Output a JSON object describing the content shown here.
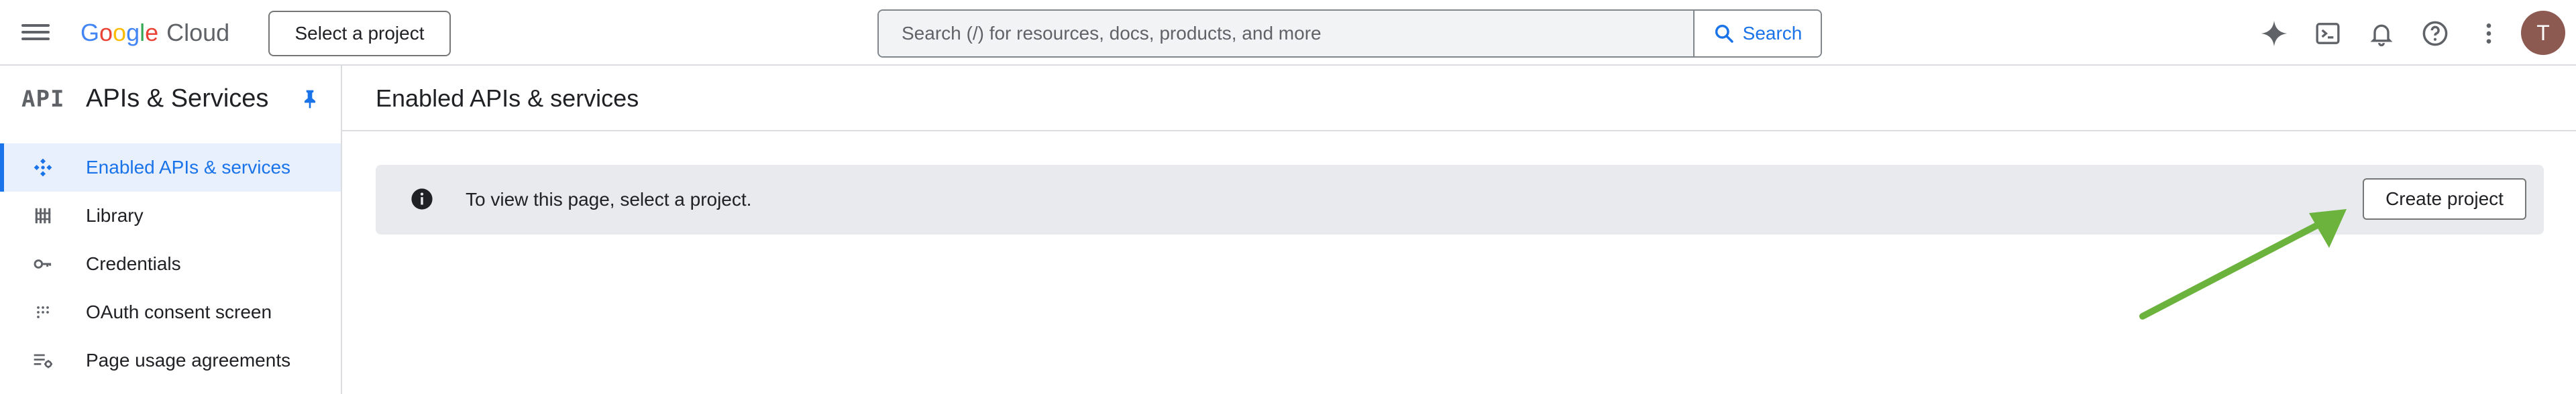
{
  "header": {
    "logo_word": "Google",
    "logo_product": "Cloud",
    "project_selector_label": "Select a project",
    "search_placeholder": "Search (/) for resources, docs, products, and more",
    "search_button_label": "Search",
    "avatar_initial": "T"
  },
  "sidebar": {
    "logo_text": "API",
    "title": "APIs & Services",
    "items": [
      {
        "label": "Enabled APIs & services",
        "icon": "api-diamond-icon",
        "active": true
      },
      {
        "label": "Library",
        "icon": "library-icon",
        "active": false
      },
      {
        "label": "Credentials",
        "icon": "key-icon",
        "active": false
      },
      {
        "label": "OAuth consent screen",
        "icon": "oauth-dots-icon",
        "active": false
      },
      {
        "label": "Page usage agreements",
        "icon": "settings-list-icon",
        "active": false
      }
    ]
  },
  "main": {
    "title": "Enabled APIs & services",
    "banner_text": "To view this page, select a project.",
    "create_project_label": "Create project"
  },
  "colors": {
    "accent": "#1a73e8",
    "annotation_arrow": "#6cb33e",
    "banner_bg": "#e8eaed",
    "avatar_bg": "#8d5a52"
  }
}
